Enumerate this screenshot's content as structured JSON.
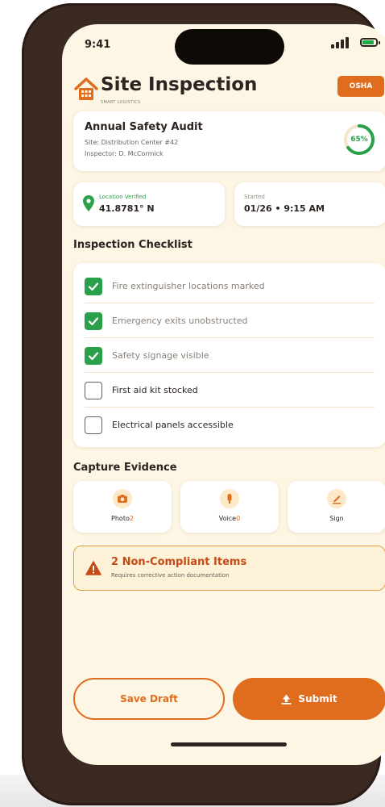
{
  "status_bar": {
    "time": "9:41"
  },
  "header": {
    "title": "Site Inspection",
    "logo_caption": "SMART LOGISTICS",
    "badge": "OSHA"
  },
  "audit": {
    "title": "Annual Safety Audit",
    "site": "Site: Distribution Center #42",
    "inspector": "Inspector: D. McCormick",
    "progress_label": "65%",
    "progress_fraction": 0.65
  },
  "location": {
    "label": "Location Verified",
    "value": "41.8781° N"
  },
  "started": {
    "label": "Started",
    "value": "01/26 • 9:15 AM"
  },
  "checklist": {
    "title": "Inspection Checklist",
    "items": [
      {
        "label": "Fire extinguisher locations marked",
        "checked": true
      },
      {
        "label": "Emergency exits unobstructed",
        "checked": true
      },
      {
        "label": "Safety signage visible",
        "checked": true
      },
      {
        "label": "First aid kit stocked",
        "checked": false
      },
      {
        "label": "Electrical panels accessible",
        "checked": false
      }
    ]
  },
  "evidence": {
    "title": "Capture Evidence",
    "buttons": [
      {
        "label": "Photo",
        "count": "2",
        "icon": "camera-icon"
      },
      {
        "label": "Voice",
        "count": "0",
        "icon": "microphone-icon"
      },
      {
        "label": "Sign",
        "count": "",
        "icon": "signature-icon"
      }
    ]
  },
  "alert": {
    "title": "2 Non-Compliant Items",
    "subtitle": "Requires corrective action documentation"
  },
  "actions": {
    "save": "Save Draft",
    "submit": "Submit"
  },
  "colors": {
    "accent": "#e06c1e",
    "success": "#2aa04a",
    "background": "#fdf6e4",
    "alert_text": "#c74a14"
  }
}
